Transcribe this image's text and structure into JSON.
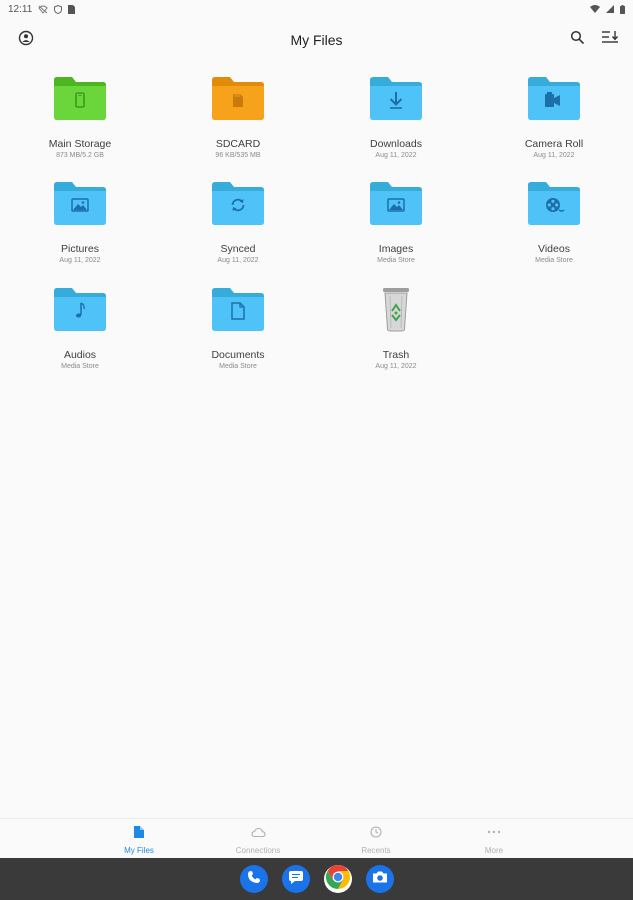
{
  "status_bar": {
    "time": "12:11"
  },
  "app_bar": {
    "title": "My Files"
  },
  "items": [
    {
      "name": "Main Storage",
      "sub": "873 MB/5.2 GB",
      "icon": "phone-icon",
      "color": "#6ad63b"
    },
    {
      "name": "SDCARD",
      "sub": "96 KB/535 MB",
      "icon": "sdcard-icon",
      "color": "#f7a21b"
    },
    {
      "name": "Downloads",
      "sub": "Aug 11, 2022",
      "icon": "download-icon",
      "color": "#4fc3f7"
    },
    {
      "name": "Camera Roll",
      "sub": "Aug 11, 2022",
      "icon": "camera-roll-icon",
      "color": "#4fc3f7"
    },
    {
      "name": "Pictures",
      "sub": "Aug 11, 2022",
      "icon": "picture-icon",
      "color": "#4fc3f7"
    },
    {
      "name": "Synced",
      "sub": "Aug 11, 2022",
      "icon": "sync-icon",
      "color": "#4fc3f7"
    },
    {
      "name": "Images",
      "sub": "Media Store",
      "icon": "image-icon",
      "color": "#4fc3f7"
    },
    {
      "name": "Videos",
      "sub": "Media Store",
      "icon": "film-reel-icon",
      "color": "#4fc3f7"
    },
    {
      "name": "Audios",
      "sub": "Media Store",
      "icon": "music-note-icon",
      "color": "#4fc3f7"
    },
    {
      "name": "Documents",
      "sub": "Media Store",
      "icon": "document-icon",
      "color": "#4fc3f7"
    },
    {
      "name": "Trash",
      "sub": "Aug 11, 2022",
      "icon": "trash-icon",
      "color": "#9e9e9e"
    }
  ],
  "bottom_nav": {
    "items": [
      {
        "label": "My Files",
        "icon": "file-icon",
        "active": true
      },
      {
        "label": "Connections",
        "icon": "cloud-icon",
        "active": false
      },
      {
        "label": "Recents",
        "icon": "clock-icon",
        "active": false
      },
      {
        "label": "More",
        "icon": "more-dots-icon",
        "active": false
      }
    ],
    "accent": "#1e88e5"
  },
  "dock": {
    "apps": [
      {
        "icon": "phone-app-icon"
      },
      {
        "icon": "messages-app-icon"
      },
      {
        "icon": "chrome-app-icon"
      },
      {
        "icon": "camera-app-icon"
      }
    ]
  }
}
